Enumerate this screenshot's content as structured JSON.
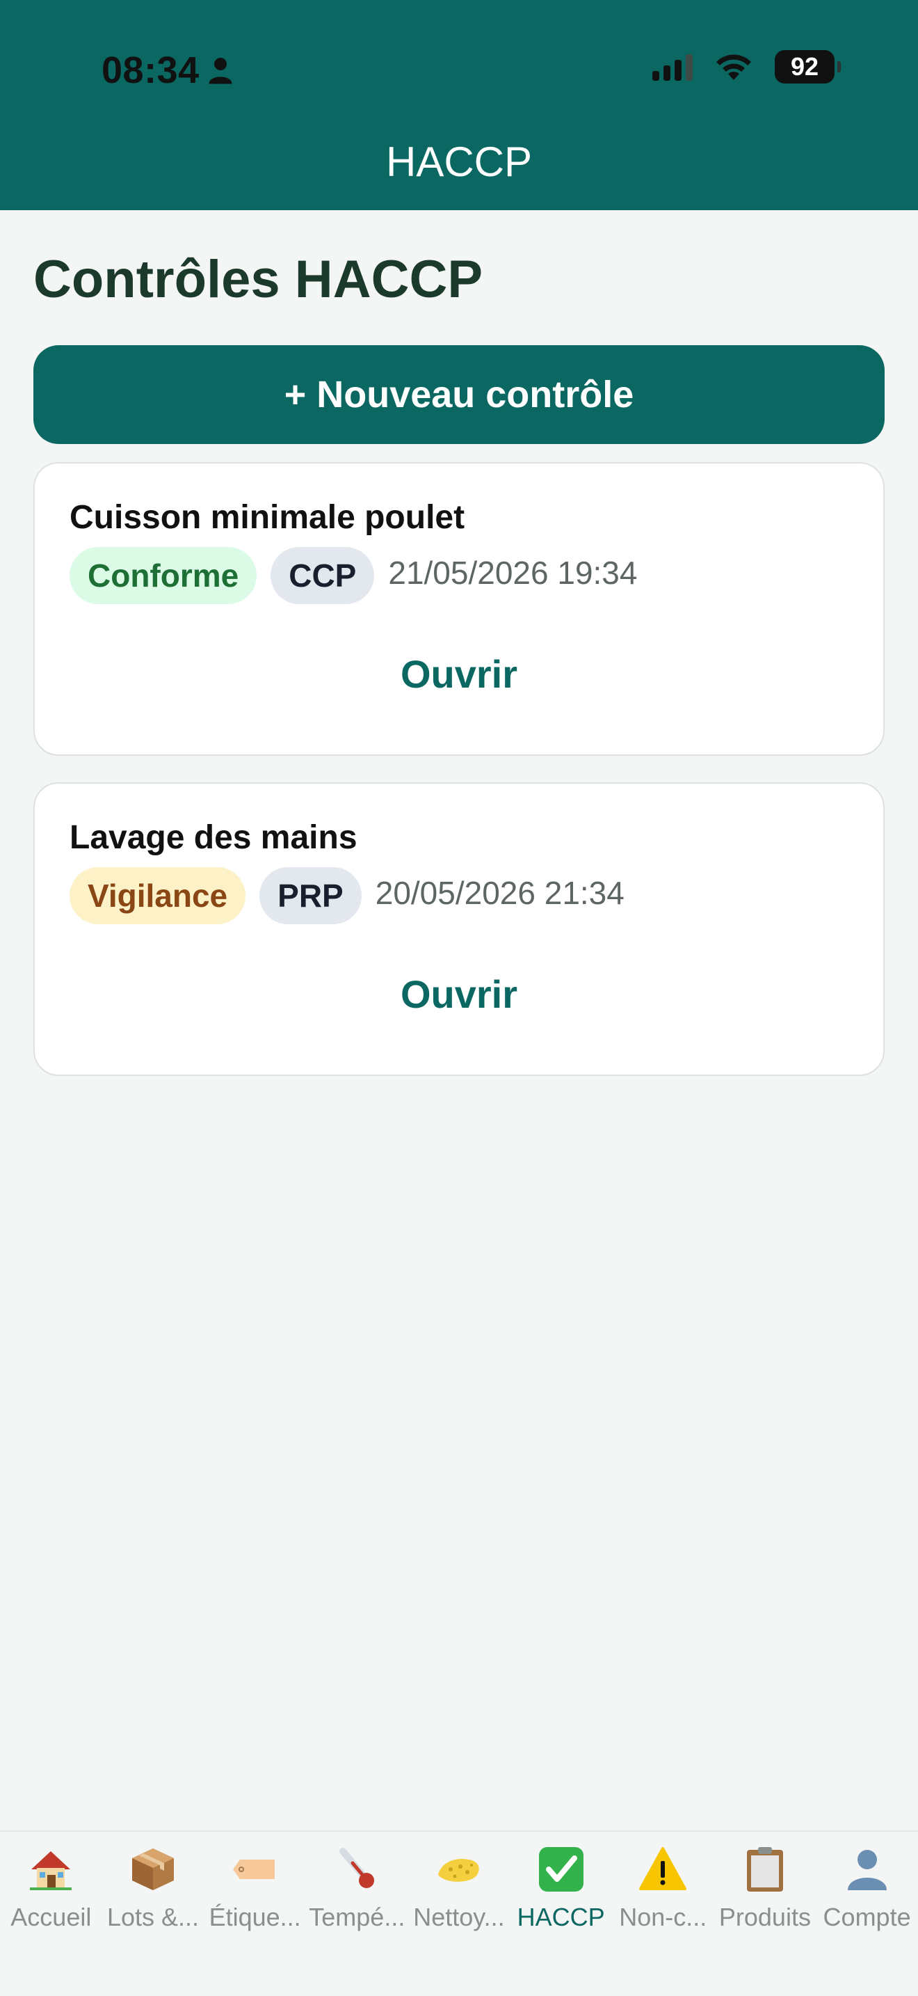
{
  "status_bar": {
    "time": "08:34",
    "battery": "92"
  },
  "header": {
    "title": "HACCP"
  },
  "page": {
    "title": "Contrôles HACCP"
  },
  "new_button": {
    "label": "+ Nouveau contrôle"
  },
  "controls": [
    {
      "title": "Cuisson minimale poulet",
      "status": "Conforme",
      "status_color": "#1e6f35",
      "type": "CCP",
      "date": "21/05/2026 19:34",
      "action": "Ouvrir"
    },
    {
      "title": "Lavage des mains",
      "status": "Vigilance",
      "status_color": "#8a4614",
      "type": "PRP",
      "date": "20/05/2026 21:34",
      "action": "Ouvrir"
    }
  ],
  "tabs": [
    {
      "label": "Accueil",
      "icon": "house-icon"
    },
    {
      "label": "Lots &...",
      "icon": "package-icon"
    },
    {
      "label": "Étique...",
      "icon": "label-tag-icon"
    },
    {
      "label": "Tempé...",
      "icon": "thermometer-icon"
    },
    {
      "label": "Nettoy...",
      "icon": "sponge-icon"
    },
    {
      "label": "HACCP",
      "icon": "check-mark-icon",
      "active": true
    },
    {
      "label": "Non-c...",
      "icon": "warning-icon"
    },
    {
      "label": "Produits",
      "icon": "clipboard-icon"
    },
    {
      "label": "Compte",
      "icon": "user-icon"
    }
  ],
  "colors": {
    "brand": "#0b6762",
    "background": "#f4f6f5"
  }
}
